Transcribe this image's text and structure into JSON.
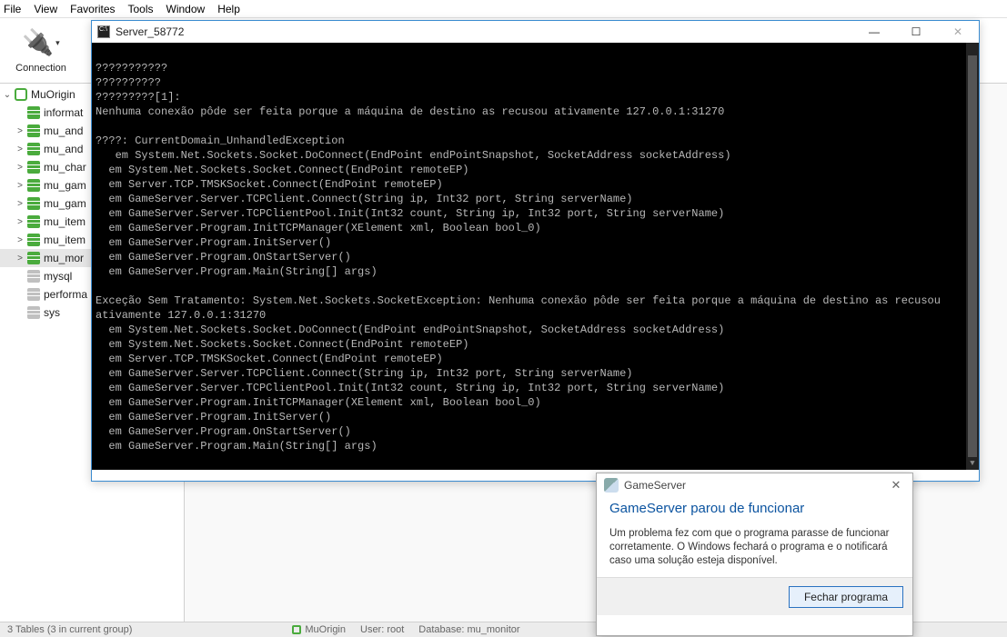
{
  "menu": [
    "File",
    "View",
    "Favorites",
    "Tools",
    "Window",
    "Help"
  ],
  "toolbar": {
    "connection_label": "Connection"
  },
  "tree": {
    "root": "MuOrigin",
    "items": [
      {
        "name": "informat",
        "expandable": false,
        "color": "green",
        "arrow": ""
      },
      {
        "name": "mu_and",
        "expandable": true,
        "color": "green",
        "arrow": ">"
      },
      {
        "name": "mu_and",
        "expandable": true,
        "color": "green",
        "arrow": ">"
      },
      {
        "name": "mu_char",
        "expandable": true,
        "color": "green",
        "arrow": ">"
      },
      {
        "name": "mu_gam",
        "expandable": true,
        "color": "green",
        "arrow": ">"
      },
      {
        "name": "mu_gam",
        "expandable": true,
        "color": "green",
        "arrow": ">"
      },
      {
        "name": "mu_item",
        "expandable": true,
        "color": "green",
        "arrow": ">"
      },
      {
        "name": "mu_item",
        "expandable": true,
        "color": "green",
        "arrow": ">"
      },
      {
        "name": "mu_mor",
        "expandable": true,
        "color": "green",
        "arrow": ">",
        "selected": true
      },
      {
        "name": "mysql",
        "expandable": false,
        "color": "grey",
        "arrow": ""
      },
      {
        "name": "performa",
        "expandable": false,
        "color": "grey",
        "arrow": ""
      },
      {
        "name": "sys",
        "expandable": false,
        "color": "grey",
        "arrow": ""
      }
    ]
  },
  "console": {
    "title": "Server_58772",
    "lines": [
      "???????????",
      "??????????",
      "?????????[1]:",
      "Nenhuma conexão pôde ser feita porque a máquina de destino as recusou ativamente 127.0.0.1:31270",
      "",
      "????: CurrentDomain_UnhandledException",
      "   em System.Net.Sockets.Socket.DoConnect(EndPoint endPointSnapshot, SocketAddress socketAddress)",
      "  em System.Net.Sockets.Socket.Connect(EndPoint remoteEP)",
      "  em Server.TCP.TMSKSocket.Connect(EndPoint remoteEP)",
      "  em GameServer.Server.TCPClient.Connect(String ip, Int32 port, String serverName)",
      "  em GameServer.Server.TCPClientPool.Init(Int32 count, String ip, Int32 port, String serverName)",
      "  em GameServer.Program.InitTCPManager(XElement xml, Boolean bool_0)",
      "  em GameServer.Program.InitServer()",
      "  em GameServer.Program.OnStartServer()",
      "  em GameServer.Program.Main(String[] args)",
      "",
      "Exceção Sem Tratamento: System.Net.Sockets.SocketException: Nenhuma conexão pôde ser feita porque a máquina de destino as recusou ativamente 127.0.0.1:31270",
      "  em System.Net.Sockets.Socket.DoConnect(EndPoint endPointSnapshot, SocketAddress socketAddress)",
      "  em System.Net.Sockets.Socket.Connect(EndPoint remoteEP)",
      "  em Server.TCP.TMSKSocket.Connect(EndPoint remoteEP)",
      "  em GameServer.Server.TCPClient.Connect(String ip, Int32 port, String serverName)",
      "  em GameServer.Server.TCPClientPool.Init(Int32 count, String ip, Int32 port, String serverName)",
      "  em GameServer.Program.InitTCPManager(XElement xml, Boolean bool_0)",
      "  em GameServer.Program.InitServer()",
      "  em GameServer.Program.OnStartServer()",
      "  em GameServer.Program.Main(String[] args)"
    ]
  },
  "dialog": {
    "title": "GameServer",
    "heading": "GameServer parou de funcionar",
    "body": "Um problema fez com que o programa parasse de funcionar corretamente. O Windows fechará o programa e o notificará caso uma solução esteja disponível.",
    "close_btn": "Fechar programa"
  },
  "status": {
    "left": "3 Tables (3 in current group)",
    "conn": "MuOrigin",
    "user": "User: root",
    "db": "Database: mu_monitor"
  }
}
